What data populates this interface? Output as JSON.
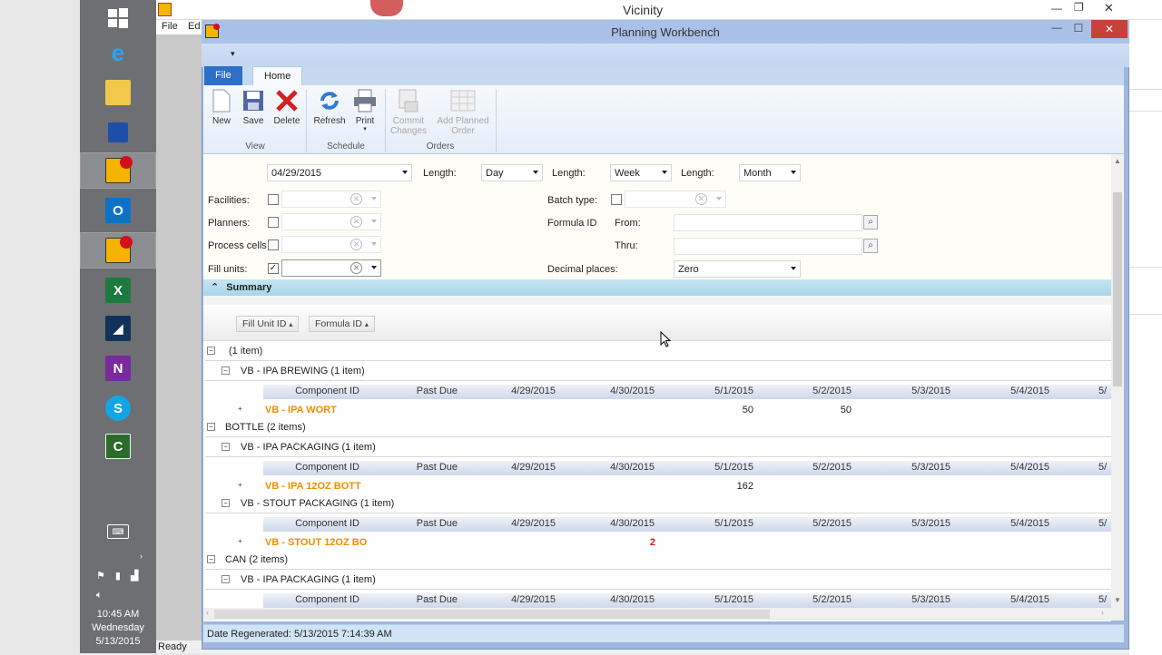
{
  "taskbar": {
    "clock": {
      "time": "10:45 AM",
      "day": "Wednesday",
      "date": "5/13/2015"
    }
  },
  "background_window": {
    "title": "Vicinity",
    "menu_file": "File",
    "menu_edit": "Ed",
    "status": "Ready"
  },
  "window": {
    "title": "Planning Workbench",
    "qat_arrow": "▾",
    "minimize": "—",
    "maximize": "☐",
    "close": "✕"
  },
  "ribbon": {
    "tabs": {
      "file": "File",
      "home": "Home"
    },
    "buttons": {
      "new": "New",
      "save": "Save",
      "delete": "Delete",
      "refresh": "Refresh",
      "print": "Print",
      "commit_1": "Commit",
      "commit_2": "Changes",
      "add_1": "Add Planned",
      "add_2": "Order"
    },
    "groups": {
      "view": "View",
      "schedule": "Schedule",
      "orders": "Orders"
    }
  },
  "filters": {
    "start_date": "04/29/2015",
    "length_label": "Length:",
    "length1": "Day",
    "length2": "Week",
    "length3": "Month",
    "facilities": "Facilities:",
    "planners": "Planners:",
    "process_cells": "Process cells",
    "fill_units": "Fill units:",
    "batch_type": "Batch type:",
    "formula_id": "Formula ID",
    "from": "From:",
    "thru": "Thru:",
    "decimal_places": "Decimal places:",
    "decimal_value": "Zero"
  },
  "summary": {
    "title": "Summary",
    "chips": {
      "fill_unit": "Fill Unit ID",
      "formula": "Formula ID"
    }
  },
  "grid": {
    "headers": [
      "Component ID",
      "Past Due",
      "4/29/2015",
      "4/30/2015",
      "5/1/2015",
      "5/2/2015",
      "5/3/2015",
      "5/4/2015",
      "5/"
    ],
    "groups": [
      {
        "label": "(1 item)"
      },
      {
        "label": "VB - IPA BREWING (1 item)"
      },
      {
        "component": "VB - IPA WORT",
        "v1": "50",
        "v2": "50"
      },
      {
        "label": "BOTTLE (2 items)"
      },
      {
        "label": "VB - IPA PACKAGING (1 item)"
      },
      {
        "component": "VB - IPA 12OZ BOTT",
        "v1": "162"
      },
      {
        "label": "VB - STOUT PACKAGING (1 item)"
      },
      {
        "component": "VB - STOUT 12OZ BO",
        "v1": "2"
      },
      {
        "label": "CAN (2 items)"
      },
      {
        "label": "VB - IPA PACKAGING (1 item)"
      }
    ]
  },
  "status": {
    "text": "Date Regenerated: 5/13/2015 7:14:39 AM"
  }
}
